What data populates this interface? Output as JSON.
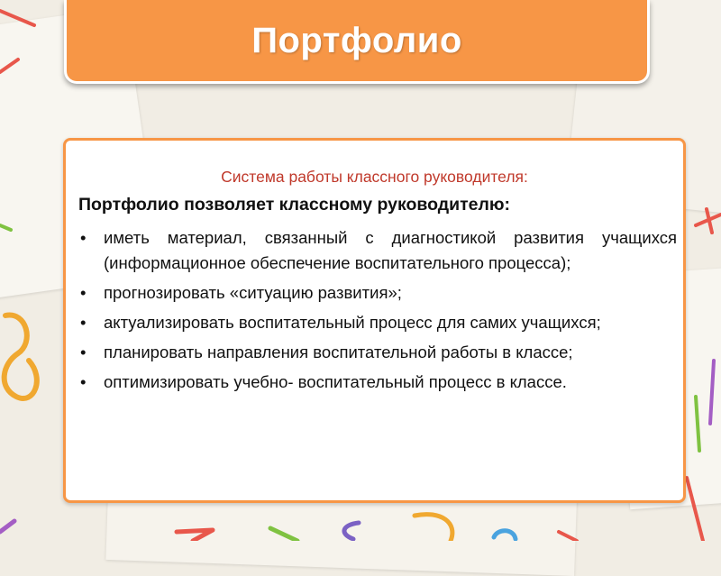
{
  "title": "Портфолио",
  "content": {
    "subtitle": "Система работы классного руководителя:",
    "lead": "Портфолио позволяет классному руководителю:",
    "bullets": [
      "иметь материал, связанный с диагностикой развития учащихся (информационное обеспечение воспитательного процесса);",
      "прогнозировать «ситуацию развития»;",
      "актуализировать воспитательный процесс для самих учащихся;",
      "планировать направления воспитательной работы в классе;",
      "оптимизировать учебно- воспитательный процесс в классе."
    ],
    "bullet_symbol": "•"
  },
  "colors": {
    "accent": "#f79646",
    "subtitle": "#c0392b",
    "background": "#f1ede4"
  }
}
